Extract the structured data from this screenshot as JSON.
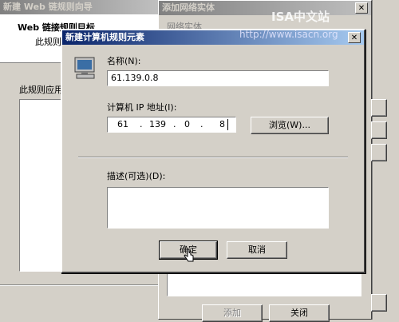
{
  "wizard": {
    "title": "新建 Web 链规则向导",
    "heading": "Web 链接规则目标",
    "subheading": "此规则",
    "body_label": "此规则应用"
  },
  "network_dialog": {
    "title": "添加网络实体",
    "close_glyph": "✕",
    "section_label": "网络实体",
    "add_button": "添加",
    "close_button": "关闭"
  },
  "computer_dialog": {
    "title": "新建计算机规则元素",
    "close_glyph": "✕",
    "name_label": "名称(N):",
    "name_value": "61.139.0.8",
    "ip_label": "计算机 IP 地址(I):",
    "ip_octets": [
      "61",
      "139",
      "0",
      "8"
    ],
    "ip_dot": ".",
    "browse_button": "浏览(W)...",
    "description_label": "描述(可选)(D):",
    "description_value": "",
    "ok_button": "确定",
    "cancel_button": "取消"
  },
  "watermark": {
    "line1": "ISA中文站",
    "line2": "http://www.isacn.org"
  }
}
